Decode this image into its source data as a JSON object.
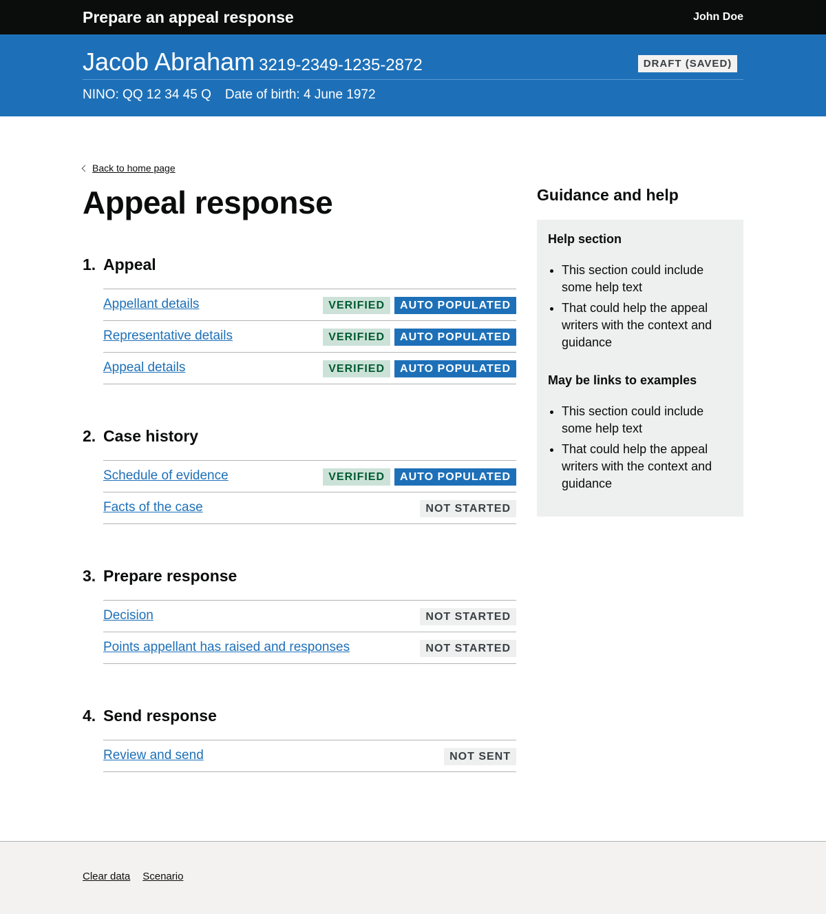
{
  "header": {
    "service_name": "Prepare an appeal response",
    "user_name": "John Doe"
  },
  "banner": {
    "appellant_name": "Jacob Abraham",
    "reference": "3219-2349-1235-2872",
    "status": "DRAFT (SAVED)",
    "nino": "NINO: QQ 12 34 45 Q",
    "dob": "Date of birth: 4 June 1972"
  },
  "back_link": "Back to home page",
  "page_title": "Appeal response",
  "tag_labels": {
    "verified": "VERIFIED",
    "auto_populated": "AUTO POPULATED",
    "not_started": "NOT STARTED",
    "not_sent": "NOT SENT"
  },
  "sections": [
    {
      "number": "1.",
      "title": "Appeal",
      "tasks": [
        {
          "label": "Appellant details",
          "tags": [
            "VERIFIED",
            "AUTO POPULATED"
          ]
        },
        {
          "label": "Representative details",
          "tags": [
            "VERIFIED",
            "AUTO POPULATED"
          ]
        },
        {
          "label": "Appeal details",
          "tags": [
            "VERIFIED",
            "AUTO POPULATED"
          ]
        }
      ]
    },
    {
      "number": "2.",
      "title": "Case history",
      "tasks": [
        {
          "label": "Schedule of evidence",
          "tags": [
            "VERIFIED",
            "AUTO POPULATED"
          ]
        },
        {
          "label": "Facts of the case",
          "tags": [
            "NOT STARTED"
          ]
        }
      ]
    },
    {
      "number": "3.",
      "title": "Prepare response",
      "tasks": [
        {
          "label": "Decision",
          "tags": [
            "NOT STARTED"
          ]
        },
        {
          "label": "Points appellant has raised and responses",
          "tags": [
            "NOT STARTED"
          ]
        }
      ]
    },
    {
      "number": "4.",
      "title": "Send response",
      "tasks": [
        {
          "label": "Review and send",
          "tags": [
            "NOT SENT"
          ]
        }
      ]
    }
  ],
  "guidance": {
    "title": "Guidance and help",
    "blocks": [
      {
        "heading": "Help section",
        "items": [
          "This section could include some help text",
          "That could help the appeal writers with the context and guidance"
        ]
      },
      {
        "heading": "May be links to examples",
        "items": [
          "This section could include some help text",
          "That could help the appeal writers with the context and guidance"
        ]
      }
    ]
  },
  "footer": {
    "links": [
      "Clear data",
      "Scenario"
    ]
  },
  "colors": {
    "header_bg": "#0b0c0c",
    "banner_bg": "#1d70b8",
    "link": "#1d70b8",
    "tag_verified_bg": "#cce2d8",
    "tag_verified_text": "#005a30",
    "tag_grey_bg": "#eeefef",
    "footer_bg": "#f3f2f1"
  }
}
